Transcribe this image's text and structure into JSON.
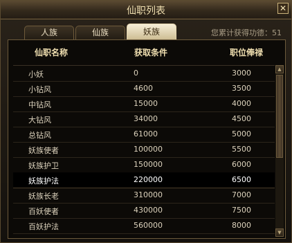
{
  "window": {
    "title": "仙职列表",
    "close_glyph": "✕"
  },
  "tabs": [
    {
      "label": "人族",
      "active": false
    },
    {
      "label": "仙族",
      "active": false
    },
    {
      "label": "妖族",
      "active": true
    }
  ],
  "merit": {
    "label": "您累计获得功德：51"
  },
  "table": {
    "headers": [
      "仙职名称",
      "获取条件",
      "职位俸禄"
    ],
    "rows": [
      [
        "小妖",
        "0",
        "3000"
      ],
      [
        "小钻风",
        "4600",
        "3500"
      ],
      [
        "中钻风",
        "15000",
        "4000"
      ],
      [
        "大钻风",
        "34000",
        "4500"
      ],
      [
        "总钻风",
        "61000",
        "5000"
      ],
      [
        "妖族使者",
        "100000",
        "5500"
      ],
      [
        "妖族护卫",
        "150000",
        "6000"
      ],
      [
        "妖族护法",
        "220000",
        "6500"
      ],
      [
        "妖族长老",
        "310000",
        "7000"
      ],
      [
        "百妖使者",
        "430000",
        "7500"
      ],
      [
        "百妖护法",
        "560000",
        "8000"
      ]
    ],
    "selected_row": 7
  },
  "scrollbar": {
    "up_glyph": "▲",
    "down_glyph": "▼"
  },
  "colors": {
    "accent": "#f0dfb0",
    "active_tab": "#e9dfc4",
    "background": "#14110d"
  }
}
